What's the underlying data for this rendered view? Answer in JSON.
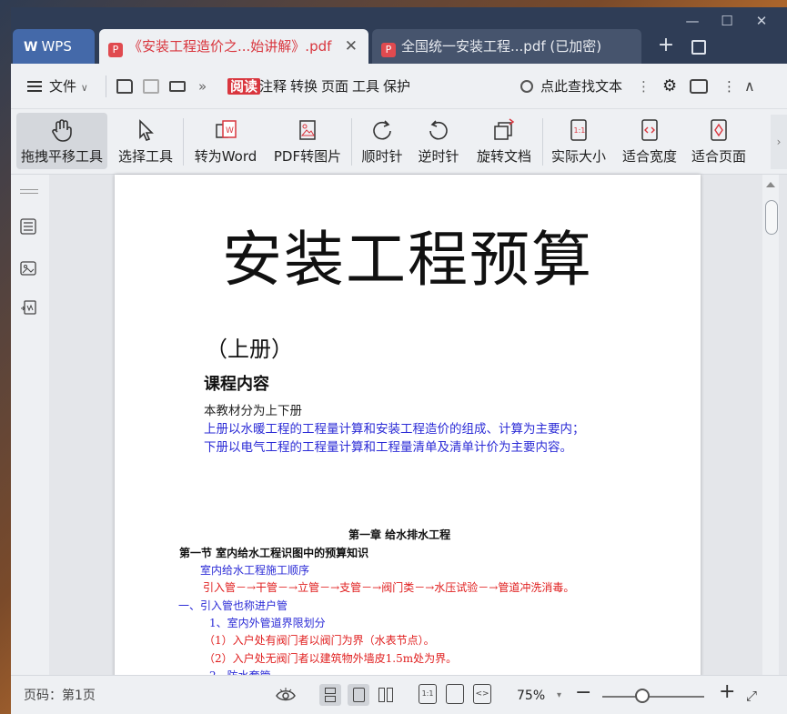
{
  "window": {
    "tabs": [
      {
        "label": "WPS",
        "type": "home"
      },
      {
        "label": "《安装工程造价之...始讲解》.pdf",
        "type": "pdf",
        "active": true
      },
      {
        "label": "全国统一安装工程...pdf (已加密)",
        "type": "pdf",
        "active": false
      }
    ],
    "controls": {
      "minimize": "—",
      "maximize": "☐",
      "close": "✕"
    }
  },
  "menubar": {
    "file_label": "文件",
    "modes": [
      {
        "label": "阅读",
        "active": true
      },
      {
        "label": "注释"
      },
      {
        "label": "转换"
      },
      {
        "label": "页面"
      },
      {
        "label": "工具"
      },
      {
        "label": "保护"
      }
    ],
    "search_placeholder": "点此查找文本"
  },
  "toolbar": {
    "tools": [
      {
        "label": "拖拽平移工具",
        "icon": "hand-icon",
        "active": true
      },
      {
        "label": "选择工具",
        "icon": "cursor-icon"
      },
      {
        "label": "转为Word",
        "icon": "pdf-to-word-icon"
      },
      {
        "label": "PDF转图片",
        "icon": "pdf-to-image-icon"
      },
      {
        "label": "顺时针",
        "icon": "rotate-cw-icon"
      },
      {
        "label": "逆时针",
        "icon": "rotate-ccw-icon"
      },
      {
        "label": "旋转文档",
        "icon": "rotate-doc-icon"
      },
      {
        "label": "实际大小",
        "icon": "actual-size-icon"
      },
      {
        "label": "适合宽度",
        "icon": "fit-width-icon"
      },
      {
        "label": "适合页面",
        "icon": "fit-page-icon"
      }
    ]
  },
  "document": {
    "title": "安装工程预算",
    "volume": "（上册）",
    "heading": "课程内容",
    "line1": "本教材分为上下册",
    "line2": "上册以水暖工程的工程量计算和安装工程造价的组成、计算为主要内；",
    "line3": "下册以电气工程的工程量计算和工程量清单及清单计价为主要内容。",
    "chapter": "第一章    给水排水工程",
    "section": "第一节  室内给水工程识图中的预算知识",
    "order_title": "室内给水工程施工顺序",
    "order_steps": "引入管－→干管－→立管－→支管－→阀门类－→水压试验－→管道冲洗消毒。",
    "item1": "一、引入管也称进户管",
    "item1_1": "1、室内外管道界限划分",
    "item1_1a": "（1）入户处有阀门者以阀门为界（水表节点）。",
    "item1_1b": "（2）入户处无阀门者以建筑物外墙皮1.5m处为界。",
    "item1_2": "2、防水套管"
  },
  "statusbar": {
    "page_label": "页码：第1页",
    "zoom": "75%"
  },
  "colors": {
    "accent": "#d9363e",
    "titlebar": "#2f3d56",
    "blue_text": "#2b2bd6",
    "red_text": "#e01e1e"
  }
}
